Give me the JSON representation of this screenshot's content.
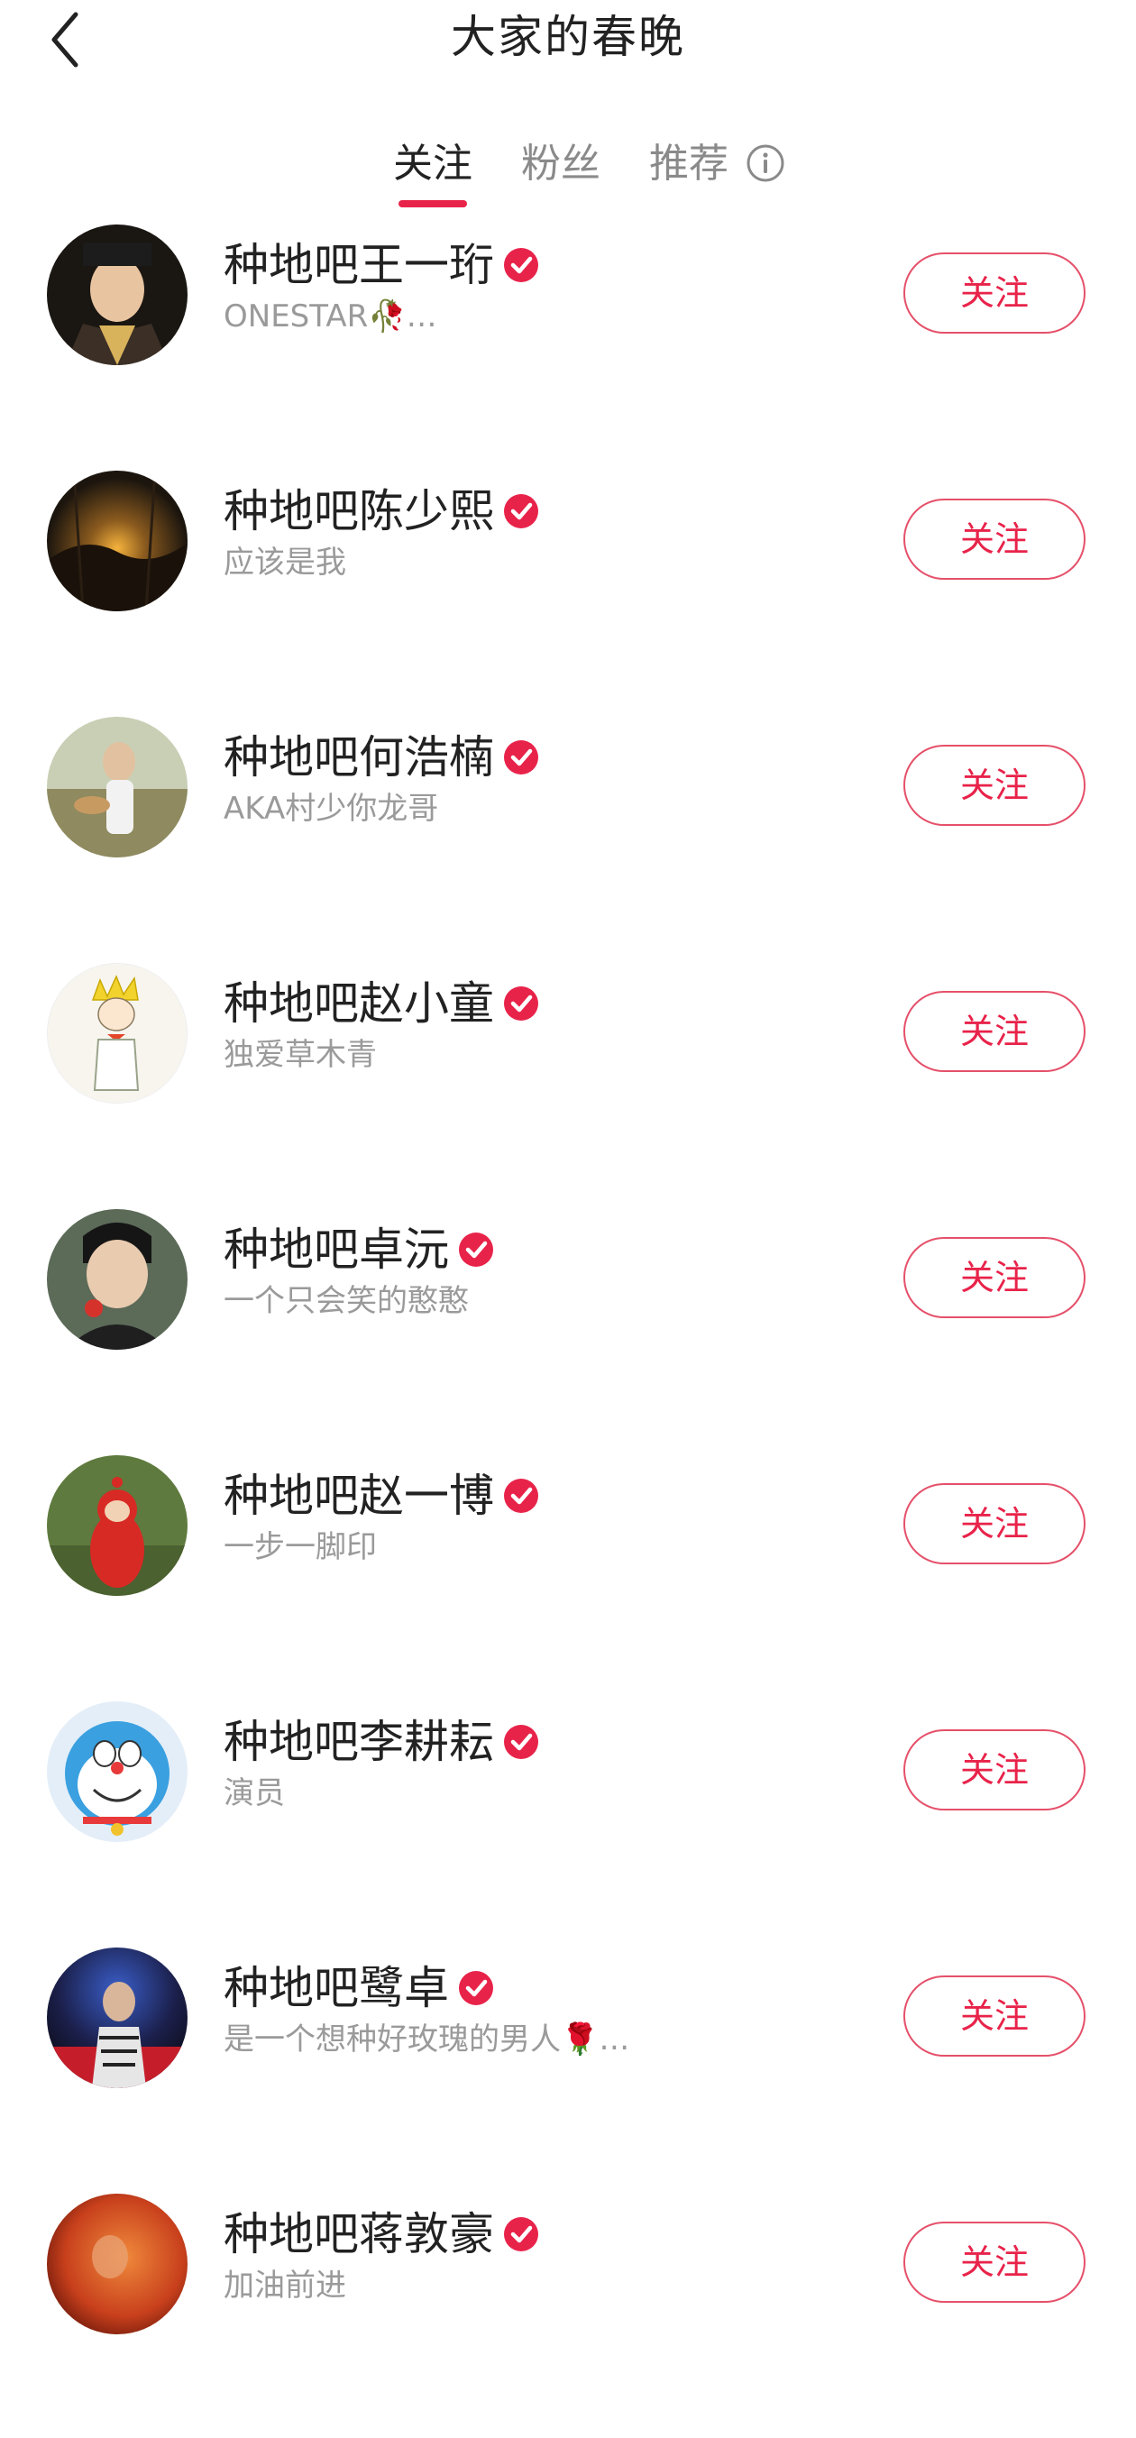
{
  "header": {
    "title": "大家的春晚"
  },
  "tabs": [
    {
      "label": "关注",
      "active": true
    },
    {
      "label": "粉丝",
      "active": false
    },
    {
      "label": "推荐",
      "active": false
    }
  ],
  "accent_color": "#e8234a",
  "users": [
    {
      "name": "种地吧王一珩",
      "bio": "ONESTAR🥀…",
      "verified": true,
      "follow_label": "关注"
    },
    {
      "name": "种地吧陈少熙",
      "bio": "应该是我",
      "verified": true,
      "follow_label": "关注"
    },
    {
      "name": "种地吧何浩楠",
      "bio": "AKA村少你龙哥",
      "verified": true,
      "follow_label": "关注"
    },
    {
      "name": "种地吧赵小童",
      "bio": "独爱草木青",
      "verified": true,
      "follow_label": "关注"
    },
    {
      "name": "种地吧卓沅",
      "bio": "一个只会笑的憨憨",
      "verified": true,
      "follow_label": "关注"
    },
    {
      "name": "种地吧赵一博",
      "bio": "一步一脚印",
      "verified": true,
      "follow_label": "关注"
    },
    {
      "name": "种地吧李耕耘",
      "bio": "演员",
      "verified": true,
      "follow_label": "关注"
    },
    {
      "name": "种地吧鹭卓",
      "bio": "是一个想种好玫瑰的男人🌹…",
      "verified": true,
      "follow_label": "关注"
    },
    {
      "name": "种地吧蒋敦豪",
      "bio": "加油前进",
      "verified": true,
      "follow_label": "关注"
    }
  ]
}
